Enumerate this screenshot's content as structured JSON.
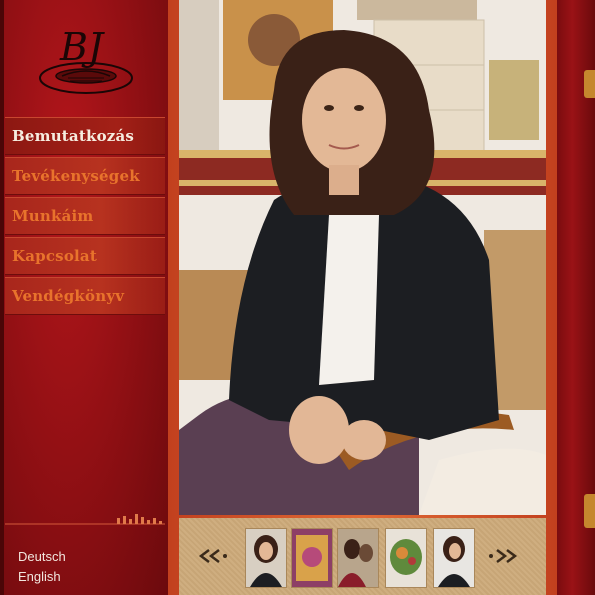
{
  "brand": {
    "logo_text": "BJ"
  },
  "nav": {
    "items": [
      {
        "label": "Bemutatkozás",
        "active": true
      },
      {
        "label": "Tevékenységek",
        "active": false
      },
      {
        "label": "Munkáim",
        "active": false
      },
      {
        "label": "Kapcsolat",
        "active": false
      },
      {
        "label": "Vendégkönyv",
        "active": false
      }
    ]
  },
  "languages": {
    "german": "Deutsch",
    "english": "English"
  },
  "gallery": {
    "prev_icon": "double-chevron-left-icon",
    "next_icon": "double-chevron-right-icon",
    "thumbnails": [
      "portrait",
      "painting",
      "people",
      "painting-green",
      "portrait-2"
    ]
  },
  "colors": {
    "sidebar_red": "#a5151a",
    "nav_text": "#e8732c",
    "nav_text_active": "#f6ede0",
    "frame_orange": "#d9602e",
    "thumb_bar": "#cfae80"
  }
}
